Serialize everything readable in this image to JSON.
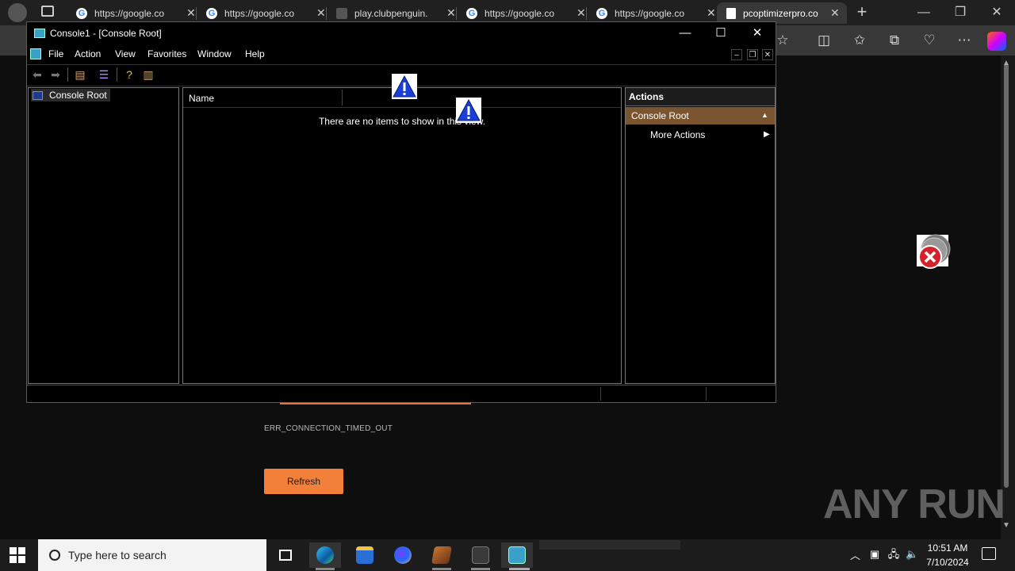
{
  "browser": {
    "tabs": [
      {
        "title": "https://google.co",
        "icon": "google-icon",
        "active": false
      },
      {
        "title": "https://google.co",
        "icon": "google-icon",
        "active": false
      },
      {
        "title": "play.clubpenguin.",
        "icon": "page-icon",
        "active": false
      },
      {
        "title": "https://google.co",
        "icon": "google-icon",
        "active": false
      },
      {
        "title": "https://google.co",
        "icon": "google-icon",
        "active": false
      },
      {
        "title": "pcoptimizerpro.co",
        "icon": "document-icon",
        "active": true
      }
    ],
    "new_tab": "+",
    "window_controls": {
      "minimize": "—",
      "restore": "❐",
      "close": "✕"
    }
  },
  "page": {
    "error_code": "ERR_CONNECTION_TIMED_OUT",
    "refresh_label": "Refresh",
    "watermark": "ANY RUN"
  },
  "mmc": {
    "title": "Console1 - [Console Root]",
    "window_controls": {
      "minimize": "—",
      "maximize": "☐",
      "close": "✕"
    },
    "menu": [
      "File",
      "Action",
      "View",
      "Favorites",
      "Window",
      "Help"
    ],
    "doc_controls": {
      "minimize": "–",
      "restore": "❐",
      "close": "✕"
    },
    "tree": {
      "root": "Console Root"
    },
    "list": {
      "column_name": "Name",
      "empty_message": "There are no items to show in this view."
    },
    "actions": {
      "title": "Actions",
      "section": "Console Root",
      "more": "More Actions"
    }
  },
  "taskbar": {
    "search_placeholder": "Type here to search",
    "time": "10:51 AM",
    "date": "7/10/2024"
  },
  "colors": {
    "accent_orange": "#f2803a",
    "actions_section": "#7a5530"
  }
}
